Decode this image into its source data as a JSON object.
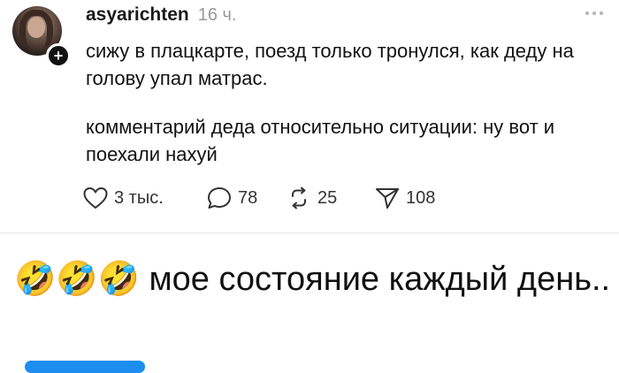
{
  "post": {
    "username": "asyarichten",
    "timestamp": "16 ч.",
    "text_1": "сижу в плацкарте, поезд только тронулся, как деду на голову упал матрас.",
    "text_2": "комментарий деда относительно ситуации: ну вот и поехали нахуй",
    "follow_label": "+",
    "icons": {
      "avatar": "avatar",
      "more": "more-dots-icon",
      "like": "heart-icon",
      "reply": "speech-bubble-icon",
      "repost": "repost-icon",
      "share": "send-icon"
    },
    "actions": {
      "likes": "3 тыс.",
      "replies": "78",
      "reposts": "25",
      "shares": "108"
    }
  },
  "caption": {
    "emoji": "🤣🤣🤣",
    "text": "мое состояние каждый день.."
  },
  "colors": {
    "text": "#111111",
    "muted": "#999999",
    "divider": "#e6e6e6",
    "accent_blue": "#1d8ef0"
  }
}
